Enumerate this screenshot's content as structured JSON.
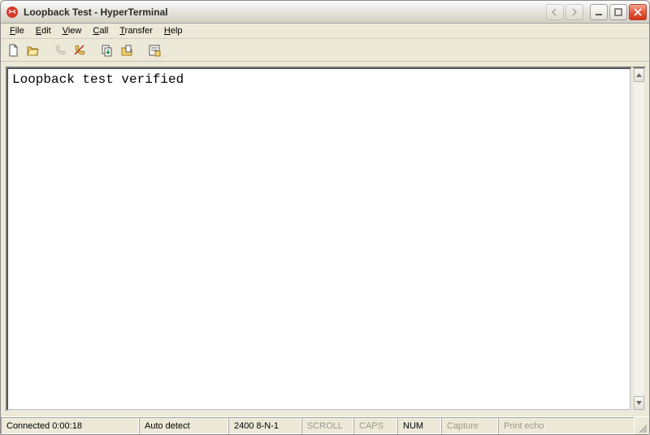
{
  "window": {
    "title": "Loopback Test - HyperTerminal"
  },
  "menu": {
    "file": {
      "label": "File",
      "ukey": "F"
    },
    "edit": {
      "label": "Edit",
      "ukey": "E"
    },
    "view": {
      "label": "View",
      "ukey": "V"
    },
    "call": {
      "label": "Call",
      "ukey": "C"
    },
    "transfer": {
      "label": "Transfer",
      "ukey": "T"
    },
    "help": {
      "label": "Help",
      "ukey": "H"
    }
  },
  "toolbar": {
    "new": {
      "name": "New",
      "icon": "document"
    },
    "open": {
      "name": "Open",
      "icon": "folder-open"
    },
    "connect": {
      "name": "Call",
      "icon": "phone"
    },
    "hangup": {
      "name": "Disconnect",
      "icon": "phone-hangup"
    },
    "send": {
      "name": "Send",
      "icon": "docs-down"
    },
    "receive": {
      "name": "Receive",
      "icon": "folder-doc"
    },
    "props": {
      "name": "Properties",
      "icon": "properties"
    }
  },
  "terminal": {
    "content": "Loopback test verified"
  },
  "status": {
    "connected": "Connected 0:00:18",
    "detect": "Auto detect",
    "settings": "2400 8-N-1",
    "scroll": "SCROLL",
    "caps": "CAPS",
    "num": "NUM",
    "capture": "Capture",
    "echo": "Print echo"
  }
}
